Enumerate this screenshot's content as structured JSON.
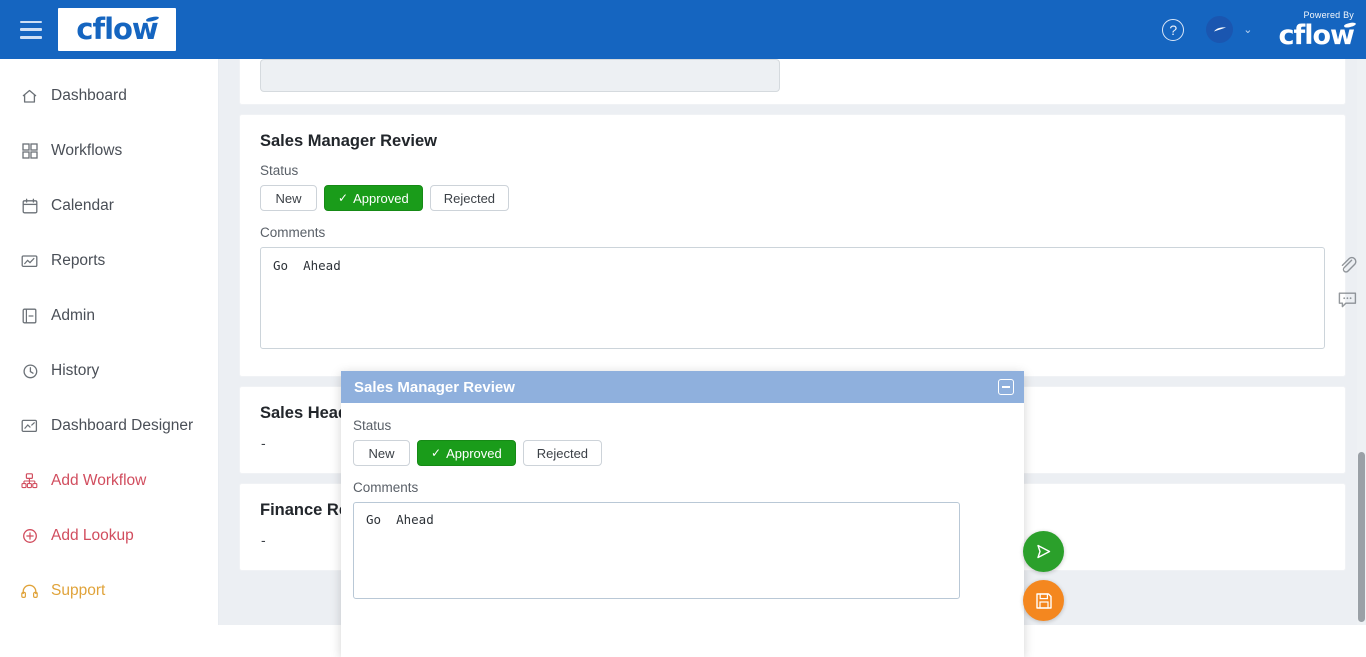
{
  "topbar": {
    "menu_icon": "hamburger-icon",
    "logo_text": "cflow",
    "help_icon": "question-circle-icon",
    "avatar_icon": "user-avatar-icon",
    "chevron": "⌄",
    "powered_by_label": "Powered By",
    "powered_by_brand": "cflow"
  },
  "sidebar": {
    "items": [
      {
        "label": "Dashboard",
        "icon": "home-icon",
        "color": "default"
      },
      {
        "label": "Workflows",
        "icon": "grid-icon",
        "color": "default"
      },
      {
        "label": "Calendar",
        "icon": "calendar-icon",
        "color": "default"
      },
      {
        "label": "Reports",
        "icon": "report-icon",
        "color": "default"
      },
      {
        "label": "Admin",
        "icon": "book-icon",
        "color": "default"
      },
      {
        "label": "History",
        "icon": "clock-history-icon",
        "color": "default"
      },
      {
        "label": "Dashboard Designer",
        "icon": "designer-icon",
        "color": "default"
      },
      {
        "label": "Add Workflow",
        "icon": "add-workflow-icon",
        "color": "red"
      },
      {
        "label": "Add Lookup",
        "icon": "add-lookup-icon",
        "color": "red"
      },
      {
        "label": "Support",
        "icon": "headset-icon",
        "color": "orange"
      }
    ]
  },
  "main": {
    "top_field_value": "",
    "sections": [
      {
        "title": "Sales Manager Review",
        "status_label": "Status",
        "status_options": [
          "New",
          "Approved",
          "Rejected"
        ],
        "status_selected": "Approved",
        "comments_label": "Comments",
        "comments_value": "Go  Ahead"
      },
      {
        "title": "Sales Head Review",
        "value": "-"
      },
      {
        "title": "Finance Review",
        "value": "-"
      }
    ]
  },
  "rail": {
    "attachment_icon": "paperclip-icon",
    "comment_icon": "comment-bubble-icon"
  },
  "modal": {
    "title": "Sales Manager Review",
    "minimize_icon": "minimize-icon",
    "status_label": "Status",
    "status_options": [
      "New",
      "Approved",
      "Rejected"
    ],
    "status_selected": "Approved",
    "check_glyph": "✓",
    "comments_label": "Comments",
    "comments_value": "Go  Ahead",
    "send_icon": "send-paper-plane-icon",
    "save_icon": "floppy-disk-save-icon"
  },
  "colors": {
    "brand_blue": "#1565C0",
    "modal_header_blue": "#8fb0dd",
    "approved_green": "#1a9c1a",
    "send_green": "#2ba02b",
    "save_orange": "#f4871f",
    "sidebar_red": "#d14d5e",
    "sidebar_orange": "#e0a33a"
  }
}
